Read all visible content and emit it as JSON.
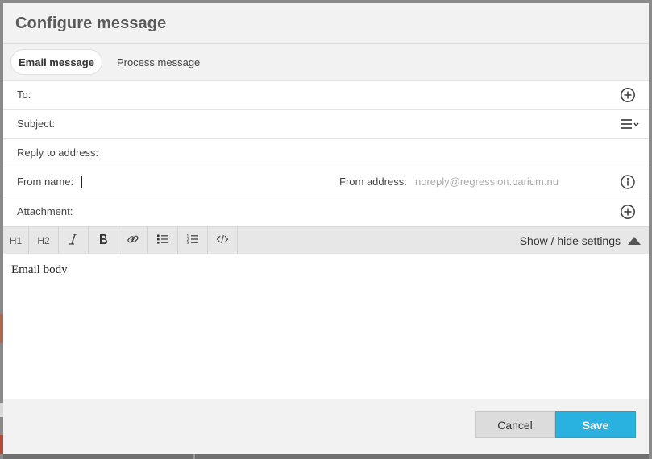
{
  "dialog": {
    "title": "Configure message"
  },
  "tabs": [
    {
      "label": "Email message",
      "active": true
    },
    {
      "label": "Process message",
      "active": false
    }
  ],
  "fields": {
    "to": {
      "label": "To:",
      "value": "",
      "icon": "add-circle-icon"
    },
    "subject": {
      "label": "Subject:",
      "value": "",
      "icon": "list-dropdown-icon"
    },
    "reply_to": {
      "label": "Reply to address:",
      "value": ""
    },
    "from_name": {
      "label": "From name:",
      "value": ""
    },
    "from_address": {
      "label": "From address:",
      "placeholder": "noreply@regression.barium.nu",
      "icon": "info-icon"
    },
    "attachment": {
      "label": "Attachment:",
      "icon": "add-circle-icon"
    }
  },
  "toolbar": {
    "buttons": [
      {
        "label": "H1",
        "icon": "heading-1-icon"
      },
      {
        "label": "H2",
        "icon": "heading-2-icon"
      },
      {
        "label": "",
        "icon": "italic-icon"
      },
      {
        "label": "",
        "icon": "bold-icon"
      },
      {
        "label": "",
        "icon": "link-icon"
      },
      {
        "label": "",
        "icon": "bullet-list-icon"
      },
      {
        "label": "",
        "icon": "numbered-list-icon"
      },
      {
        "label": "",
        "icon": "code-icon"
      }
    ],
    "settings_toggle": "Show / hide settings"
  },
  "editor": {
    "content": "Email body"
  },
  "footer": {
    "cancel": "Cancel",
    "save": "Save"
  },
  "colors": {
    "accent": "#29b2e0",
    "title": "#5b5b5b",
    "toolbar_bg": "#e7e7e7"
  }
}
